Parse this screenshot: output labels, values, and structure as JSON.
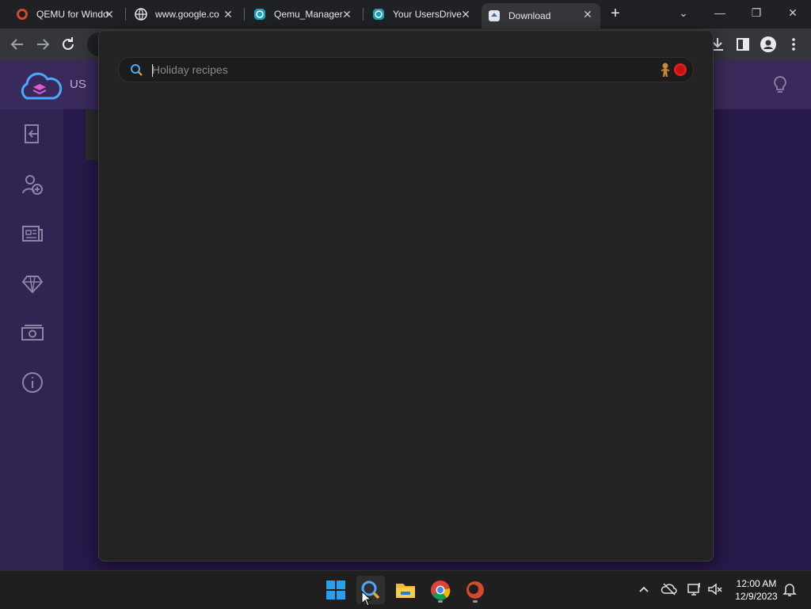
{
  "browser": {
    "tabs": [
      {
        "title": "QEMU for Windo",
        "icon": "qemu-icon"
      },
      {
        "title": "www.google.co",
        "icon": "globe-icon"
      },
      {
        "title": "Qemu_Manager",
        "icon": "qemu-manager-icon"
      },
      {
        "title": "Your UsersDrive",
        "icon": "usersdrive-icon"
      },
      {
        "title": "Download",
        "icon": "download-page-icon",
        "active": true
      }
    ],
    "close_glyph": "✕",
    "new_tab_glyph": "+",
    "window_controls": {
      "menu": "⌄",
      "minimize": "—",
      "maximize": "❐",
      "close": "✕"
    }
  },
  "page": {
    "header_text": "US",
    "sidebar_icons": [
      "logout-icon",
      "add-user-icon",
      "news-icon",
      "diamond-icon",
      "money-icon",
      "info-icon"
    ]
  },
  "search": {
    "placeholder": "Holiday recipes",
    "value": "",
    "doodle": "gingerbread-doodle-icon"
  },
  "taskbar": {
    "apps": [
      "windows-start-icon",
      "search-app-icon",
      "file-explorer-icon",
      "chrome-icon",
      "qemu-app-icon"
    ],
    "clock_time": "12:00 AM",
    "clock_date": "12/9/2023"
  },
  "colors": {
    "page_header": "#3a2a5c",
    "page_sidebar": "#2f2452",
    "page_main": "#27194a",
    "overlay": "#232323",
    "accent_blue": "#4aa8ff"
  }
}
